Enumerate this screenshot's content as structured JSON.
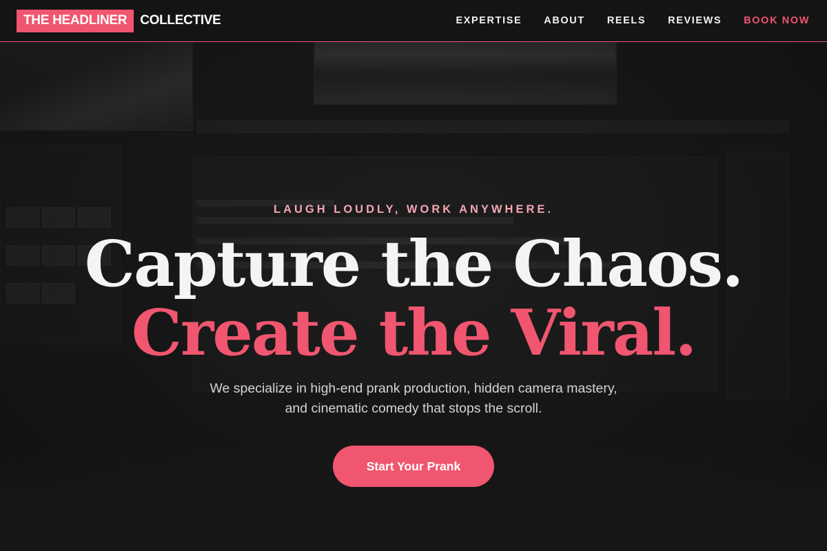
{
  "brand": {
    "badge": "THE HEADLINER",
    "name": "COLLECTIVE",
    "accent": "#f0566f"
  },
  "nav": {
    "items": [
      {
        "label": "EXPERTISE"
      },
      {
        "label": "ABOUT"
      },
      {
        "label": "REELS"
      },
      {
        "label": "REVIEWS"
      },
      {
        "label": "BOOK NOW"
      }
    ]
  },
  "hero": {
    "eyebrow": "LAUGH LOUDLY, WORK ANYWHERE.",
    "headline_line1": "Capture the Chaos.",
    "headline_line2": "Create the Viral.",
    "subtitle": "We specialize in high-end prank production, hidden camera mastery, and cinematic comedy that stops the scroll.",
    "cta_label": "Start Your Prank"
  }
}
